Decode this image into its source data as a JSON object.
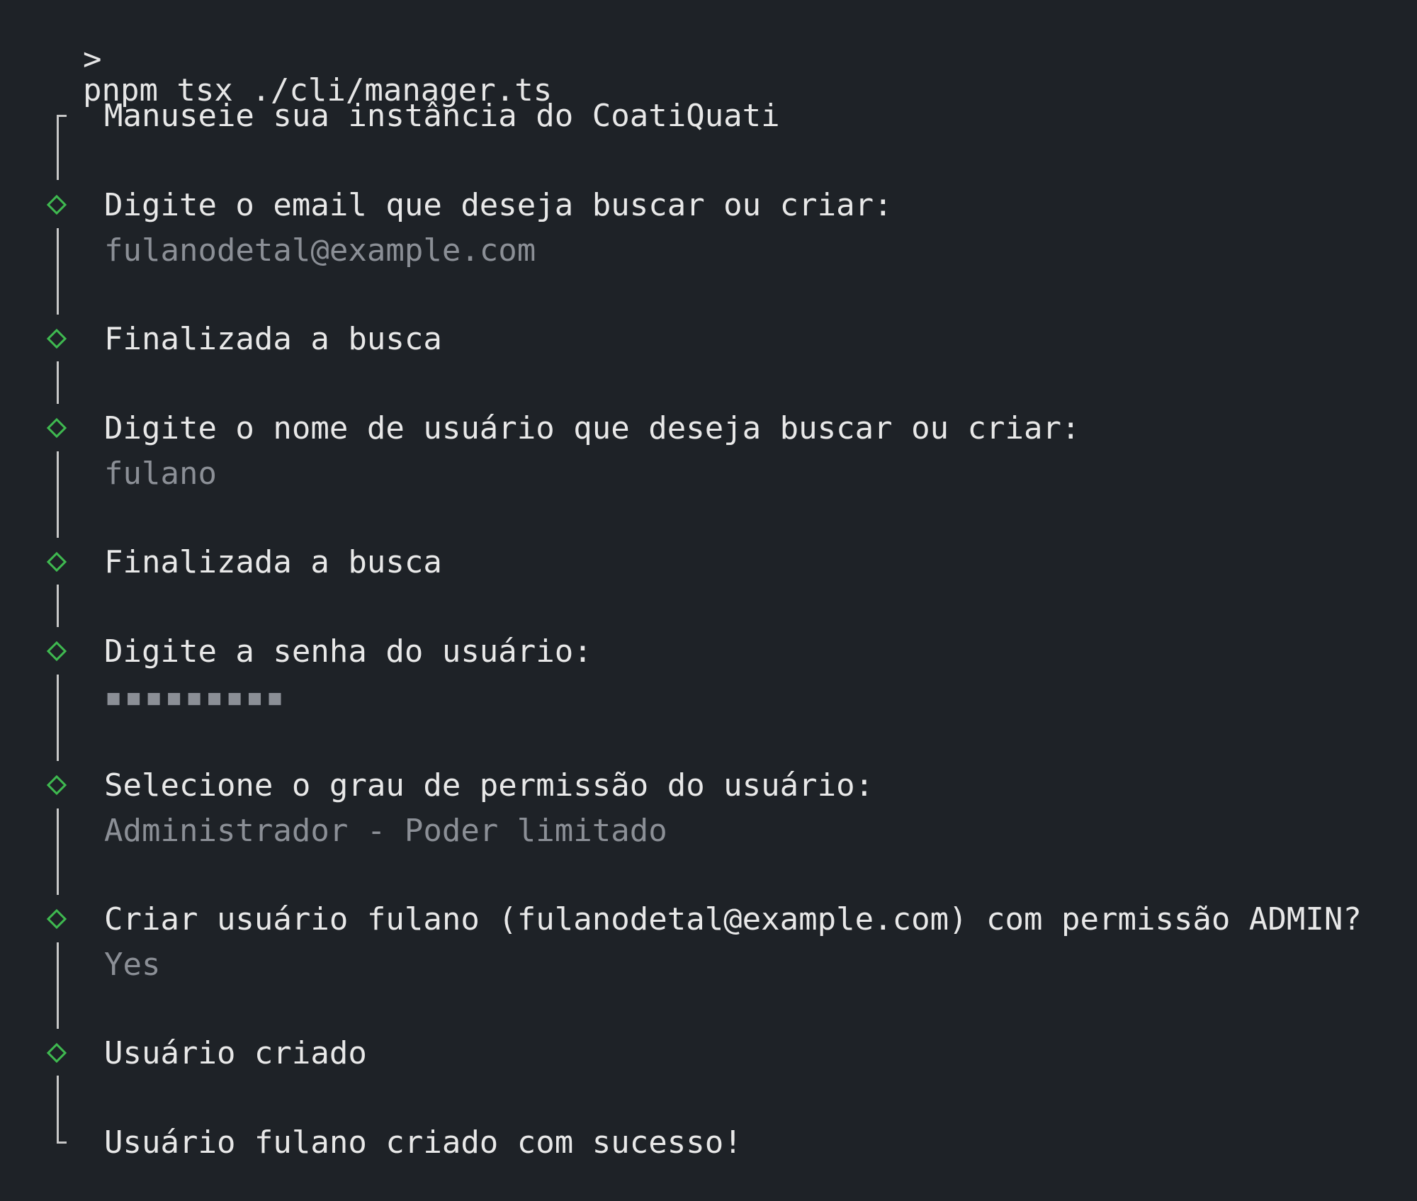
{
  "terminal": {
    "prompt_symbol": ">",
    "command": "pnpm tsx ./cli/manager.ts"
  },
  "session": {
    "intro": "Manuseie sua instância do CoatiQuati",
    "steps": [
      {
        "label": "Digite o email que deseja buscar ou criar:",
        "value": "fulanodetal@example.com"
      },
      {
        "label": "Finalizada a busca",
        "value": ""
      },
      {
        "label": "Digite o nome de usuário que deseja buscar ou criar:",
        "value": "fulano"
      },
      {
        "label": "Finalizada a busca",
        "value": ""
      },
      {
        "label": "Digite a senha do usuário:",
        "value": "▪▪▪▪▪▪▪▪▪"
      },
      {
        "label": "Selecione o grau de permissão do usuário:",
        "value": "Administrador - Poder limitado"
      },
      {
        "label": "Criar usuário fulano (fulanodetal@example.com) com permissão ADMIN?",
        "value": "Yes"
      },
      {
        "label": "Usuário criado",
        "value": ""
      }
    ],
    "outro": "Usuário fulano criado com sucesso!"
  },
  "colors": {
    "background": "#1e2227",
    "accent_green": "#3fb950",
    "muted_text": "#8b8f96"
  }
}
